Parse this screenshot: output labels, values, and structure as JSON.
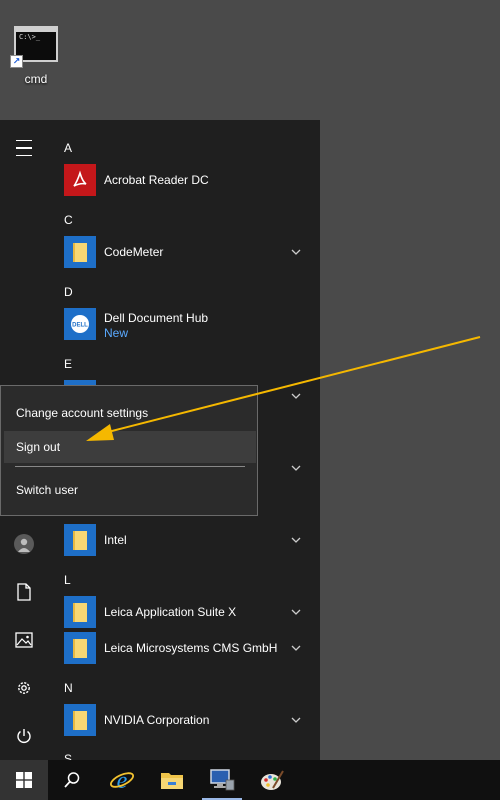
{
  "desktop": {
    "icons": [
      {
        "label": "cmd",
        "icon": "cmd-icon",
        "thumb_text": "C:\\>_"
      }
    ]
  },
  "start_menu": {
    "rail": {
      "menu_icon": "hamburger-icon",
      "items": [
        "user-icon",
        "document-icon",
        "pictures-icon",
        "gear-icon",
        "power-icon"
      ]
    },
    "letters": {
      "a": "A",
      "c": "C",
      "d": "D",
      "e": "E",
      "l": "L",
      "n": "N",
      "s": "S"
    },
    "apps": {
      "acrobat": {
        "name": "Acrobat Reader DC"
      },
      "codemeter": {
        "name": "CodeMeter"
      },
      "dell": {
        "name": "Dell Document Hub",
        "badge": "New"
      },
      "intel": {
        "name": "Intel"
      },
      "leica_suite": {
        "name": "Leica Application Suite X"
      },
      "leica_cms": {
        "name": "Leica Microsystems CMS GmbH"
      },
      "nvidia": {
        "name": "NVIDIA Corporation"
      }
    }
  },
  "account_popup": {
    "change_settings": "Change account settings",
    "sign_out": "Sign out",
    "switch_user": "Switch user"
  },
  "taskbar": {
    "items": [
      "windows-start-icon",
      "search-icon",
      "internet-explorer-icon",
      "file-explorer-icon",
      "server-manager-icon",
      "paint-icon"
    ]
  },
  "colors": {
    "arrow": "#f5b800",
    "link_blue": "#5aa9ff",
    "tile_blue": "#1e6fc8",
    "acrobat_red": "#c4171a"
  }
}
